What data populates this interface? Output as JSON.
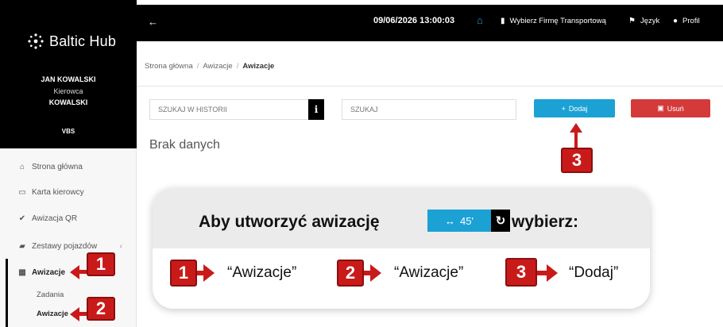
{
  "app": {
    "logo_text": "Baltic Hub"
  },
  "user": {
    "name": "JAN KOWALSKI",
    "role": "Kierowca",
    "company": "KOWALSKI",
    "terminal": "VBS"
  },
  "topbar": {
    "back_icon": "arrow-left-icon",
    "datetime": "09/06/2026 13:00:03",
    "home_icon": "home-icon",
    "transport_label": "Wybierz Firmę Transportową",
    "language_label": "Język",
    "profile_label": "Profil"
  },
  "sidebar": {
    "items": [
      {
        "label": "Strona główna",
        "icon": "home-icon"
      },
      {
        "label": "Karta kierowcy",
        "icon": "id-card-icon"
      },
      {
        "label": "Awizacja QR",
        "icon": "check-icon"
      },
      {
        "label": "Zestawy pojazdów",
        "icon": "truck-icon"
      },
      {
        "label": "Awizacje",
        "icon": "calendar-icon"
      }
    ],
    "subitems": [
      {
        "label": "Zadania"
      },
      {
        "label": "Awizacje"
      }
    ]
  },
  "breadcrumb": {
    "items": [
      "Strona główna",
      "Awizacje",
      "Awizacje"
    ],
    "separator": "/"
  },
  "toolbar": {
    "history_search_placeholder": "SZUKAJ W HISTORII",
    "info_label": "i",
    "search_placeholder": "SZUKAJ",
    "add_label": "Dodaj",
    "delete_label": "Usuń"
  },
  "main": {
    "empty_text": "Brak danych"
  },
  "instruction": {
    "title_before": "Aby utworzyć awizację",
    "chip_label": "45'",
    "title_after": "wybierz:",
    "steps": [
      {
        "number": "1",
        "label": "“Awizacje”"
      },
      {
        "number": "2",
        "label": "“Awizacje”"
      },
      {
        "number": "3",
        "label": "“Dodaj”"
      }
    ]
  },
  "markers": {
    "sidebar_awizacje": "1",
    "sidebar_sub_awizacje": "2",
    "add_button": "3"
  },
  "colors": {
    "accent_blue": "#1ba1d4",
    "danger_red": "#d43a3a",
    "marker_red": "#c91a1a",
    "topbar_black": "#000000"
  }
}
